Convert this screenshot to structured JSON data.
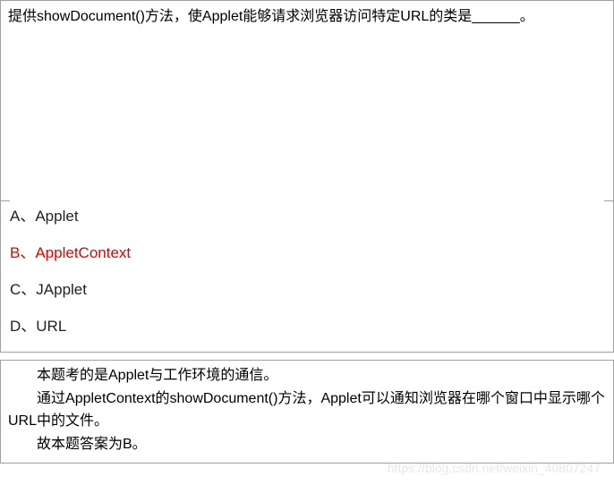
{
  "question": {
    "text": "提供showDocument()方法，使Applet能够请求浏览器访问特定URL的类是______。"
  },
  "options": [
    {
      "letter": "A、",
      "text": "Applet",
      "correct": false
    },
    {
      "letter": "B、",
      "text": "AppletContext",
      "correct": true
    },
    {
      "letter": "C、",
      "text": "JApplet",
      "correct": false
    },
    {
      "letter": "D、",
      "text": "URL",
      "correct": false
    }
  ],
  "explanation": {
    "line1": "本题考的是Applet与工作环境的通信。",
    "line2": "通过AppletContext的showDocument()方法，Applet可以通知浏览器在哪个窗口中显示哪个URL中的文件。",
    "line3": "故本题答案为B。"
  },
  "watermark": "https://blog.csdn.net/weixin_40807247"
}
